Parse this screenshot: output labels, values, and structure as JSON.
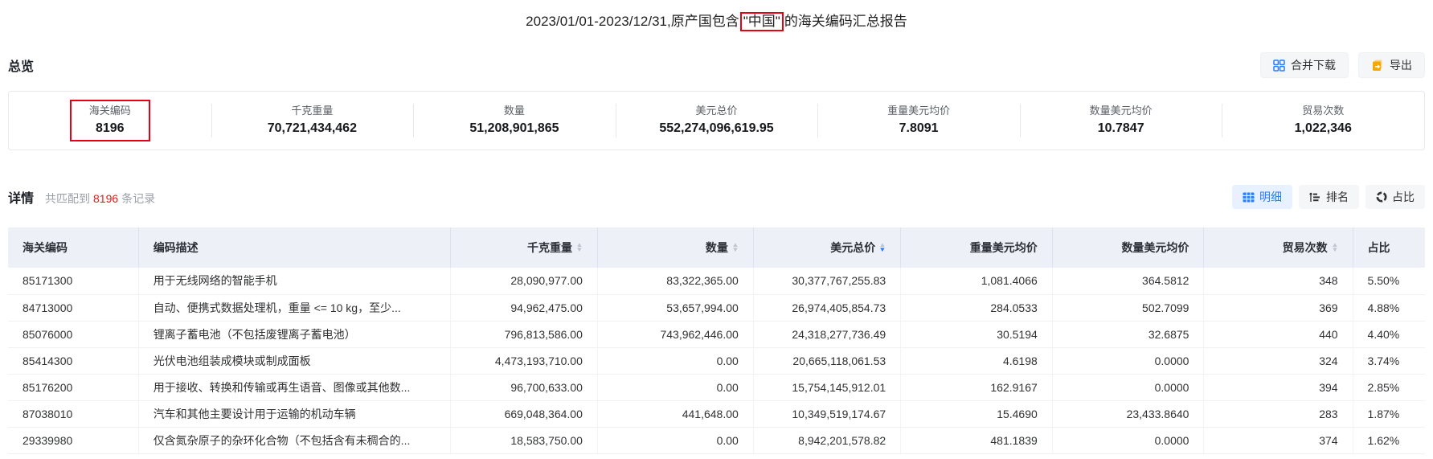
{
  "title": {
    "prefix": "2023/01/01-2023/12/31,原产国包含",
    "highlight": "\"中国\"",
    "suffix": "的海关编码汇总报告"
  },
  "overview": {
    "heading": "总览",
    "merge_download_label": "合并下载",
    "export_label": "导出",
    "stats": [
      {
        "label": "海关编码",
        "value": "8196",
        "highlighted": true
      },
      {
        "label": "千克重量",
        "value": "70,721,434,462",
        "highlighted": false
      },
      {
        "label": "数量",
        "value": "51,208,901,865",
        "highlighted": false
      },
      {
        "label": "美元总价",
        "value": "552,274,096,619.95",
        "highlighted": false
      },
      {
        "label": "重量美元均价",
        "value": "7.8091",
        "highlighted": false
      },
      {
        "label": "数量美元均价",
        "value": "10.7847",
        "highlighted": false
      },
      {
        "label": "贸易次数",
        "value": "1,022,346",
        "highlighted": false
      }
    ]
  },
  "detail": {
    "heading": "详情",
    "match_prefix": "共匹配到",
    "match_count": "8196",
    "match_suffix": "条记录",
    "view_tabs": [
      {
        "label": "明细",
        "active": true
      },
      {
        "label": "排名",
        "active": false
      },
      {
        "label": "占比",
        "active": false
      }
    ]
  },
  "table": {
    "columns": [
      {
        "label": "海关编码",
        "align": "left",
        "sortable": false,
        "sorted": null
      },
      {
        "label": "编码描述",
        "align": "left",
        "sortable": false,
        "sorted": null
      },
      {
        "label": "千克重量",
        "align": "right",
        "sortable": true,
        "sorted": null
      },
      {
        "label": "数量",
        "align": "right",
        "sortable": true,
        "sorted": null
      },
      {
        "label": "美元总价",
        "align": "right",
        "sortable": true,
        "sorted": "desc"
      },
      {
        "label": "重量美元均价",
        "align": "right",
        "sortable": false,
        "sorted": null
      },
      {
        "label": "数量美元均价",
        "align": "right",
        "sortable": false,
        "sorted": null
      },
      {
        "label": "贸易次数",
        "align": "right",
        "sortable": true,
        "sorted": null
      },
      {
        "label": "占比",
        "align": "left",
        "sortable": false,
        "sorted": null
      }
    ],
    "rows": [
      [
        "85171300",
        "用于无线网络的智能手机",
        "28,090,977.00",
        "83,322,365.00",
        "30,377,767,255.83",
        "1,081.4066",
        "364.5812",
        "348",
        "5.50%"
      ],
      [
        "84713000",
        "自动、便携式数据处理机，重量 <= 10 kg，至少...",
        "94,962,475.00",
        "53,657,994.00",
        "26,974,405,854.73",
        "284.0533",
        "502.7099",
        "369",
        "4.88%"
      ],
      [
        "85076000",
        "锂离子蓄电池（不包括废锂离子蓄电池）",
        "796,813,586.00",
        "743,962,446.00",
        "24,318,277,736.49",
        "30.5194",
        "32.6875",
        "440",
        "4.40%"
      ],
      [
        "85414300",
        "光伏电池组装成模块或制成面板",
        "4,473,193,710.00",
        "0.00",
        "20,665,118,061.53",
        "4.6198",
        "0.0000",
        "324",
        "3.74%"
      ],
      [
        "85176200",
        "用于接收、转换和传输或再生语音、图像或其他数...",
        "96,700,633.00",
        "0.00",
        "15,754,145,912.01",
        "162.9167",
        "0.0000",
        "394",
        "2.85%"
      ],
      [
        "87038010",
        "汽车和其他主要设计用于运输的机动车辆",
        "669,048,364.00",
        "441,648.00",
        "10,349,519,174.67",
        "15.4690",
        "23,433.8640",
        "283",
        "1.87%"
      ],
      [
        "29339980",
        "仅含氮杂原子的杂环化合物（不包括含有未稠合的...",
        "18,583,750.00",
        "0.00",
        "8,942,201,578.82",
        "481.1839",
        "0.0000",
        "374",
        "1.62%"
      ]
    ]
  },
  "colors": {
    "accent_blue": "#2b7cff",
    "annotation_red": "#e60012",
    "count_red": "#f01414",
    "export_orange": "#f7a800",
    "header_bg": "#eef0f7"
  }
}
